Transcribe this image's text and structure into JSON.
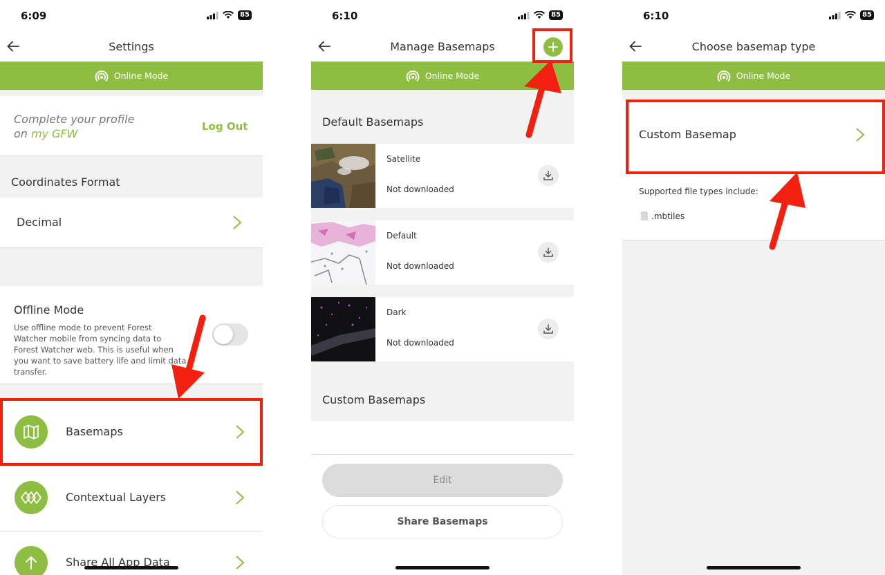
{
  "colors": {
    "brand_green": "#8dbe42",
    "highlight_red": "#f2200f"
  },
  "screen1": {
    "time": "6:09",
    "battery": "85",
    "title": "Settings",
    "online_mode": "Online Mode",
    "profile_line1": "Complete your profile",
    "profile_line2_prefix": "on ",
    "profile_line2_link": "my GFW",
    "logout": "Log Out",
    "coordinates_header": "Coordinates Format",
    "coordinates_value": "Decimal",
    "offline_title": "Offline Mode",
    "offline_desc": "Use offline mode to prevent Forest Watcher mobile from syncing data to Forest Watcher web. This is useful when you want to save battery life and limit data transfer.",
    "menu": [
      {
        "label": "Basemaps",
        "icon": "map-icon"
      },
      {
        "label": "Contextual Layers",
        "icon": "layers-icon"
      },
      {
        "label": "Share All App Data",
        "icon": "upload-icon"
      }
    ]
  },
  "screen2": {
    "time": "6:10",
    "battery": "85",
    "title": "Manage Basemaps",
    "online_mode": "Online Mode",
    "default_header": "Default Basemaps",
    "basemaps": [
      {
        "name": "Satellite",
        "status": "Not downloaded"
      },
      {
        "name": "Default",
        "status": "Not downloaded"
      },
      {
        "name": "Dark",
        "status": "Not downloaded"
      }
    ],
    "custom_header": "Custom Basemaps",
    "edit_button": "Edit",
    "share_button": "Share Basemaps"
  },
  "screen3": {
    "time": "6:10",
    "battery": "85",
    "title": "Choose basemap type",
    "online_mode": "Online Mode",
    "custom_basemap": "Custom Basemap",
    "supported_label": "Supported file types include:",
    "file_type": ".mbtiles"
  }
}
